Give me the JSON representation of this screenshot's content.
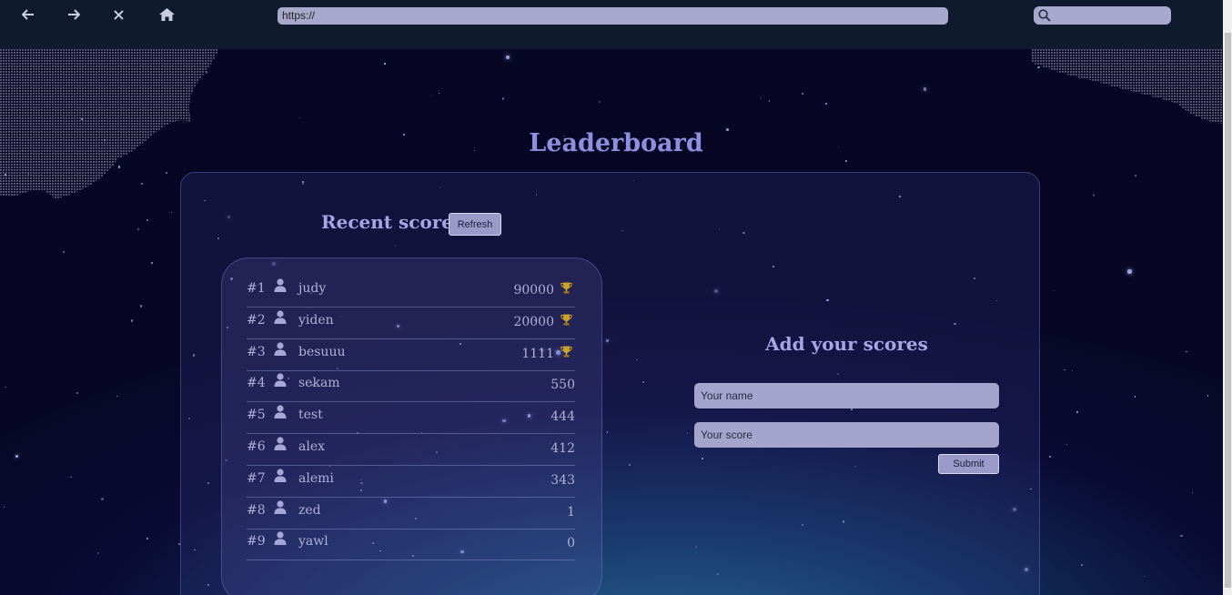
{
  "browser": {
    "url": "https://",
    "search_value": ""
  },
  "page": {
    "title": "Leaderboard"
  },
  "recent": {
    "title": "Recent scores",
    "refresh_label": "Refresh"
  },
  "scores": [
    {
      "rank": "#1",
      "name": "judy",
      "score": "90000",
      "trophy": true
    },
    {
      "rank": "#2",
      "name": "yiden",
      "score": "20000",
      "trophy": true
    },
    {
      "rank": "#3",
      "name": "besuuu",
      "score": "1111",
      "trophy": true
    },
    {
      "rank": "#4",
      "name": "sekam",
      "score": "550",
      "trophy": false
    },
    {
      "rank": "#5",
      "name": "test",
      "score": "444",
      "trophy": false
    },
    {
      "rank": "#6",
      "name": "alex",
      "score": "412",
      "trophy": false
    },
    {
      "rank": "#7",
      "name": "alemi",
      "score": "343",
      "trophy": false
    },
    {
      "rank": "#8",
      "name": "zed",
      "score": "1",
      "trophy": false
    },
    {
      "rank": "#9",
      "name": "yawl",
      "score": "0",
      "trophy": false
    }
  ],
  "add": {
    "title": "Add your scores",
    "name_placeholder": "Your name",
    "score_placeholder": "Your score",
    "submit_label": "Submit"
  },
  "icons": {
    "back": "arrow-left-icon",
    "forward": "arrow-right-icon",
    "close": "close-icon",
    "home": "home-icon",
    "search": "search-icon",
    "user": "user-icon",
    "trophy": "trophy-icon"
  },
  "colors": {
    "accent": "#8f8fe0",
    "button": "#9a9ac8",
    "trophy": "#c9a227"
  }
}
